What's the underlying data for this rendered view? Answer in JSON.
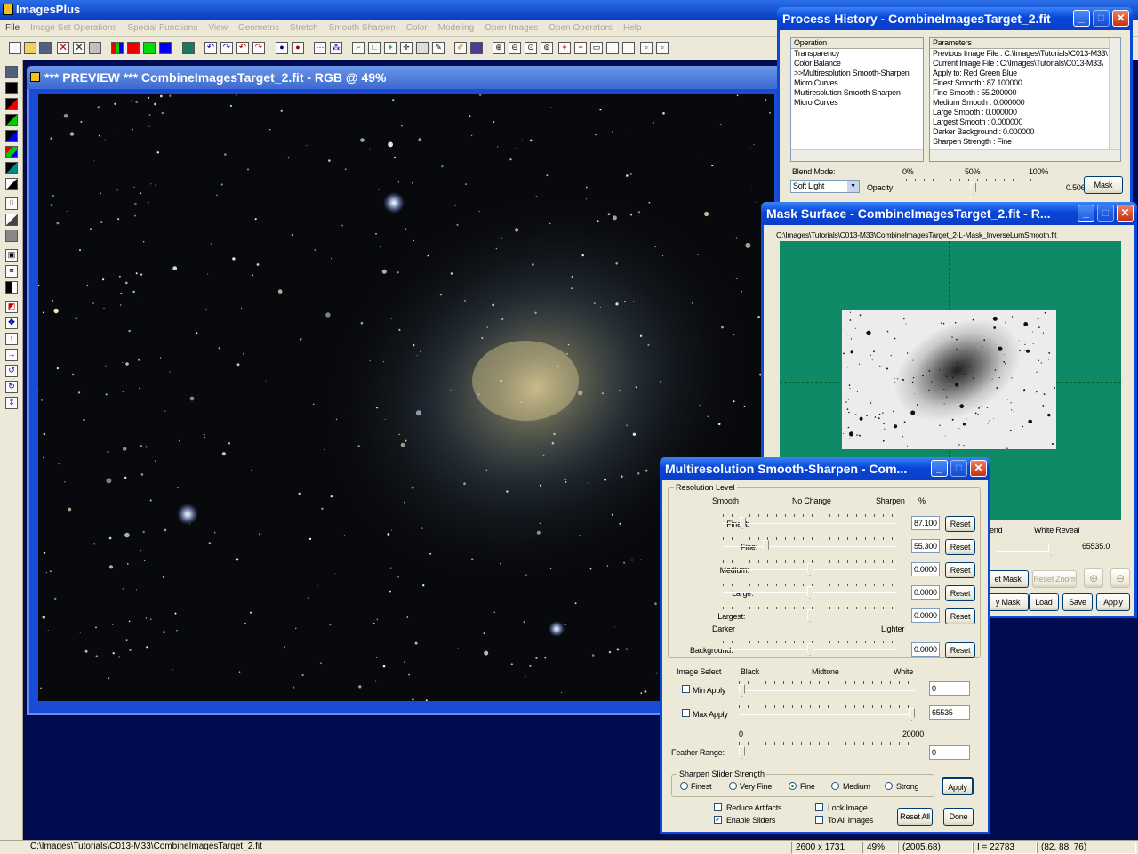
{
  "app": {
    "title": "ImagesPlus"
  },
  "menu": [
    "File",
    "Image Set Operations",
    "Special Functions",
    "View",
    "Geometric",
    "Stretch",
    "Smooth Sharpen",
    "Color",
    "Modeling",
    "Open Images",
    "Open Operators",
    "Help"
  ],
  "preview": {
    "title": "*** PREVIEW *** CombineImagesTarget_2.fit - RGB @  49%"
  },
  "history": {
    "title": "Process History - CombineImagesTarget_2.fit",
    "operation_header": "Operation",
    "parameters_header": "Parameters",
    "operations": [
      "Transparency",
      "Color Balance",
      ">>Multiresolution Smooth-Sharpen",
      "Micro Curves",
      "Multiresolution Smooth-Sharpen",
      "Micro Curves"
    ],
    "parameters": [
      "Previous Image File : C:\\Images\\Tutorials\\C013-M33\\",
      "Current Image File : C:\\Images\\Tutorials\\C013-M33\\",
      "Apply to:  Red Green Blue",
      "Finest Smooth : 87.100000",
      "Fine Smooth : 55.200000",
      "Medium Smooth : 0.000000",
      "Large Smooth : 0.000000",
      "Largest Smooth : 0.000000",
      "Darker Background : 0.000000",
      "Sharpen Strength : Fine"
    ],
    "blend_mode_label": "Blend Mode:",
    "blend_mode": "Soft Light",
    "opacity_label": "Opacity:",
    "pct0": "0%",
    "pct50": "50%",
    "pct100": "100%",
    "opacity_value": "0.506",
    "opacity": 0.506,
    "mask_button": "Mask"
  },
  "mask": {
    "title": "Mask Surface - CombineImagesTarget_2.fit - R...",
    "path": "C:\\Images\\Tutorials\\C013-M33\\CombineImagesTarget_2-L-Mask_InverseLumSmooth.fit",
    "blend_partial": "end",
    "white_reveal_label": "White Reveal",
    "white_reveal_value": "65535.0",
    "set_mask": "et Mask",
    "reset_zoom": "Reset Zoom",
    "ay_mask": "y Mask",
    "load": "Load",
    "save": "Save",
    "apply": "Apply",
    "colors": {
      "surface": "#0e8a66"
    }
  },
  "msharp": {
    "title": "Multiresolution Smooth-Sharpen - Com...",
    "resolution_level": "Resolution Level",
    "smooth": "Smooth",
    "no_change": "No Change",
    "sharpen": "Sharpen",
    "pct": "%",
    "rows": [
      {
        "label": "Finest:",
        "value": "87.100",
        "reset": "Reset",
        "level": 0.1
      },
      {
        "label": "Fine:",
        "value": "55.300",
        "reset": "Reset",
        "level": 0.24
      },
      {
        "label": "Medium:",
        "value": "0.0000",
        "reset": "Reset",
        "level": 0.5
      },
      {
        "label": "Large:",
        "value": "0.0000",
        "reset": "Reset",
        "level": 0.5
      },
      {
        "label": "Largest:",
        "value": "0.0000",
        "reset": "Reset",
        "level": 0.5
      }
    ],
    "darker": "Darker",
    "lighter": "Lighter",
    "background": {
      "label": "Background:",
      "value": "0.0000",
      "reset": "Reset",
      "level": 0.5
    },
    "image_select": "Image Select",
    "black": "Black",
    "midtone": "Midtone",
    "white": "White",
    "min_apply": {
      "label": "Min Apply",
      "value": "0",
      "level": 0.0
    },
    "max_apply": {
      "label": "Max Apply",
      "value": "65535",
      "level": 1.0
    },
    "range_min": "0",
    "range_max": "20000",
    "feather": {
      "label": "Feather Range:",
      "value": "0",
      "level": 0.0
    },
    "sharpen_strength": "Sharpen Slider Strength",
    "strengths": [
      "Finest",
      "Very Fine",
      "Fine",
      "Medium",
      "Strong"
    ],
    "selected_strength": "Fine",
    "apply": "Apply",
    "reduce_artifacts": "Reduce Artifacts",
    "enable_sliders": "Enable Sliders",
    "lock_image": "Lock Image",
    "to_all_images": "To All Images",
    "reset_all": "Reset All",
    "done": "Done"
  },
  "status": {
    "path": "C:\\Images\\Tutorials\\C013-M33\\CombineImagesTarget_2.fit",
    "size": "2600 x 1731",
    "zoom": "49%",
    "coords": "(2005,68)",
    "intensity": "I = 22783",
    "rgb": "(82, 88, 76)"
  }
}
